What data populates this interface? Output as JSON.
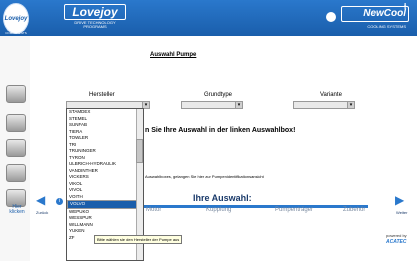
{
  "header": {
    "left_logo_text": "Lovejoy",
    "left_logo_sub": "HYDRAULIC COMPONENTS",
    "brand": "Lovejoy",
    "tagline": "DRIVE TECHNOLOGY PROGRAMS",
    "right_brand": "NewCool",
    "right_sub": "COOLING SYSTEMS",
    "right_letter": "Ɨ"
  },
  "main": {
    "title": "Auswahl Pumpe",
    "columns": {
      "hersteller": "Hersteller",
      "grundtype": "Grundtype",
      "variante": "Variante"
    },
    "message": "n Sie Ihre Auswahl in der linken Auswahlbox!",
    "message2": "Auswahlboxes, gelangen Sie hier zur Pumpenidentifikationsansicht",
    "selection_title": "Ihre Auswahl:",
    "steps": [
      "Motor",
      "Kupplung",
      "Pumpenträger",
      "Zubehör"
    ],
    "nav": {
      "back_label": "Zurück",
      "next_label": "Weiter"
    },
    "footer_small": "powered by",
    "footer_brand": "ACATEC"
  },
  "dropdown": {
    "items": [
      "STAMDEX",
      "STEMEL",
      "SUNFAB",
      "TIERA",
      "TOWLER",
      "TRI",
      "TRUNINGER",
      "TYRON",
      "ULBRICH-HYDRAULIK",
      "VANDINTHER",
      "VICKERS",
      "VIKOL",
      "VIVOL",
      "VOITH",
      "VOLVO",
      "WEPUKO",
      "WESSPUR",
      "WILLMANN",
      "YUKEN",
      "ZF"
    ],
    "selected_index": 14,
    "tooltip": "Bitte wählen sie den Hersteller der Pumpe aus"
  },
  "rail": {
    "tip_label": "Hier klicken"
  }
}
